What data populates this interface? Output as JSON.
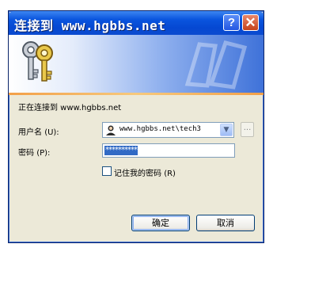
{
  "dialog": {
    "title": "连接到 www.hgbbs.net",
    "help_glyph": "?",
    "close_glyph": "✕",
    "connecting_text": "正在连接到 www.hgbbs.net",
    "username_label": "用户名",
    "username_accel": "(U):",
    "username_value": "www.hgbbs.net\\tech3",
    "password_label": "密码",
    "password_accel": "(P):",
    "password_value": "**********",
    "remember_label": "记住我的密码",
    "remember_accel": "(R)",
    "remember_checked": false,
    "ok_label": "确定",
    "cancel_label": "取消",
    "browse_label": "...",
    "combo_arrow": "▼"
  },
  "colors": {
    "title_bar": "#0548d2",
    "close_button": "#c4421c",
    "dialog_bg": "#ece9d8",
    "selection": "#316ac5"
  }
}
